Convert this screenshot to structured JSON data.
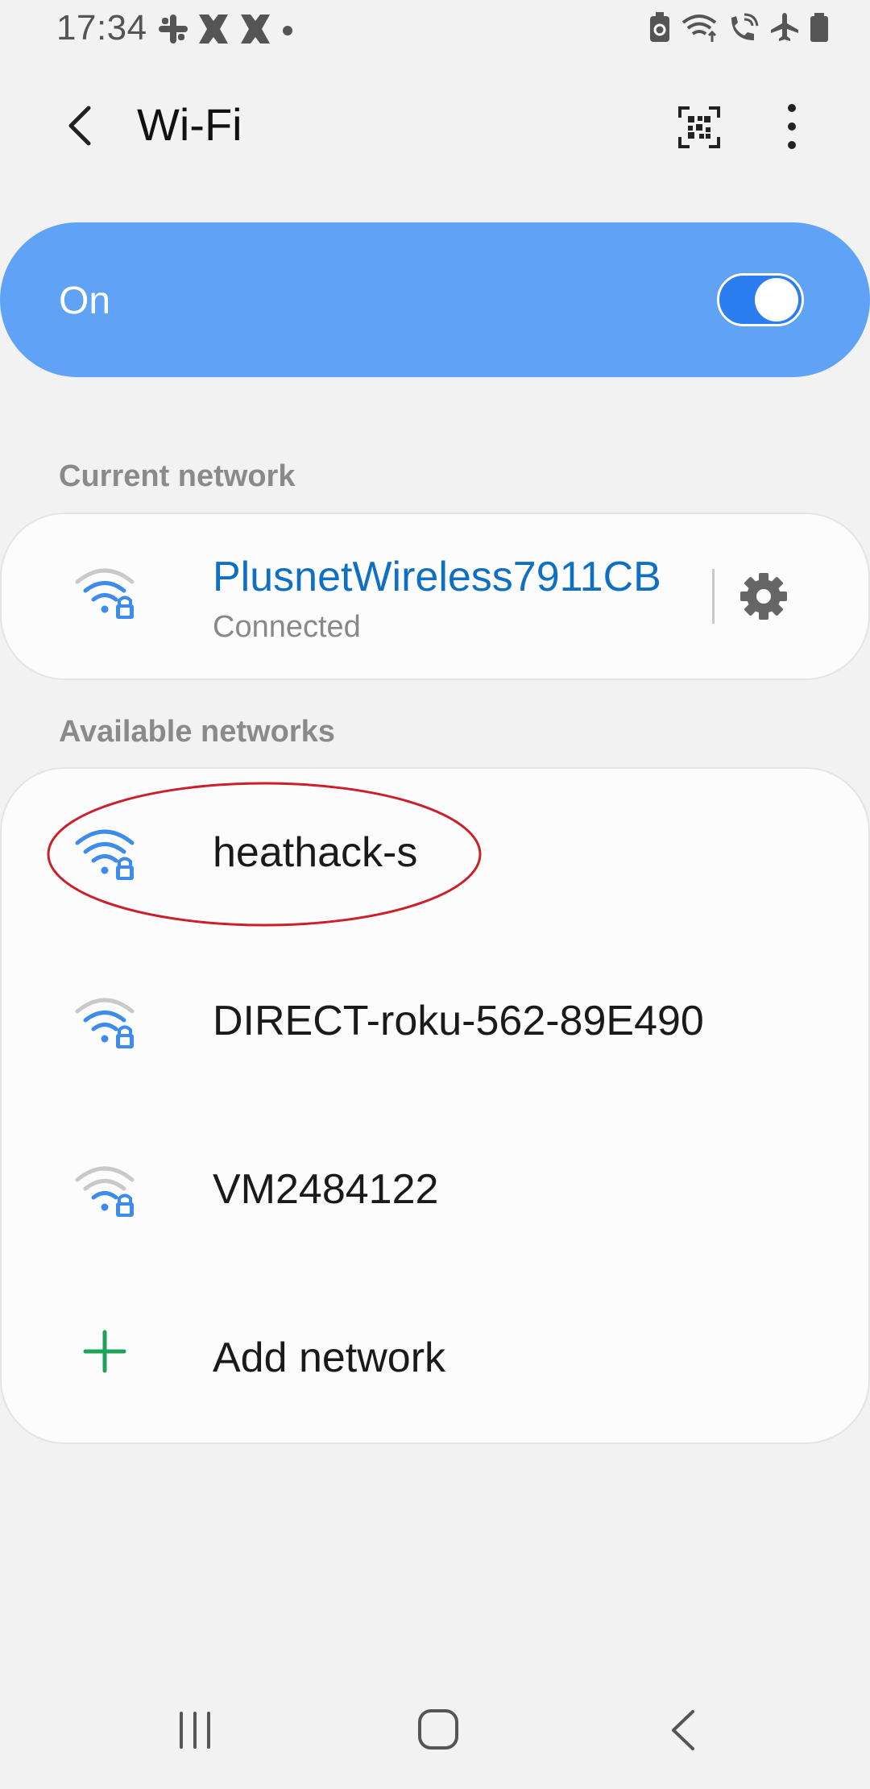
{
  "status_bar": {
    "time": "17:34",
    "left_icons": [
      "slack-icon",
      "hashtag-notification-icon",
      "hashtag-notification-icon",
      "dot-icon"
    ],
    "right_icons": [
      "battery-saver-icon",
      "wifi-icon",
      "wifi-calling-icon",
      "airplane-icon",
      "battery-icon"
    ]
  },
  "header": {
    "title": "Wi-Fi",
    "back_icon": "back-arrow-icon",
    "qr_icon": "qr-code-icon",
    "more_icon": "more-options-icon"
  },
  "master_toggle": {
    "label": "On",
    "state": "on",
    "color": "#5fa2f6"
  },
  "current_network": {
    "section_label": "Current network",
    "name": "PlusnetWireless7911CB",
    "status": "Connected",
    "icon": "wifi-lock-icon",
    "settings_icon": "gear-icon",
    "name_color": "#0f6fc4"
  },
  "available_networks": {
    "section_label": "Available networks",
    "items": [
      {
        "name": "heathack-s",
        "icon": "wifi-lock-icon",
        "signal": "full",
        "highlighted": true
      },
      {
        "name": "DIRECT-roku-562-89E490",
        "icon": "wifi-lock-icon",
        "signal": "medium"
      },
      {
        "name": "VM2484122",
        "icon": "wifi-lock-icon",
        "signal": "low"
      }
    ],
    "add_label": "Add network",
    "add_icon": "plus-icon"
  },
  "nav_bar": {
    "recents_icon": "recents-icon",
    "home_icon": "home-icon",
    "back_icon": "back-icon"
  },
  "colors": {
    "accent": "#5fa2f6",
    "highlight": "#cc1f2a",
    "add_green": "#1ea35a",
    "wifi_blue": "#3d8bea"
  }
}
